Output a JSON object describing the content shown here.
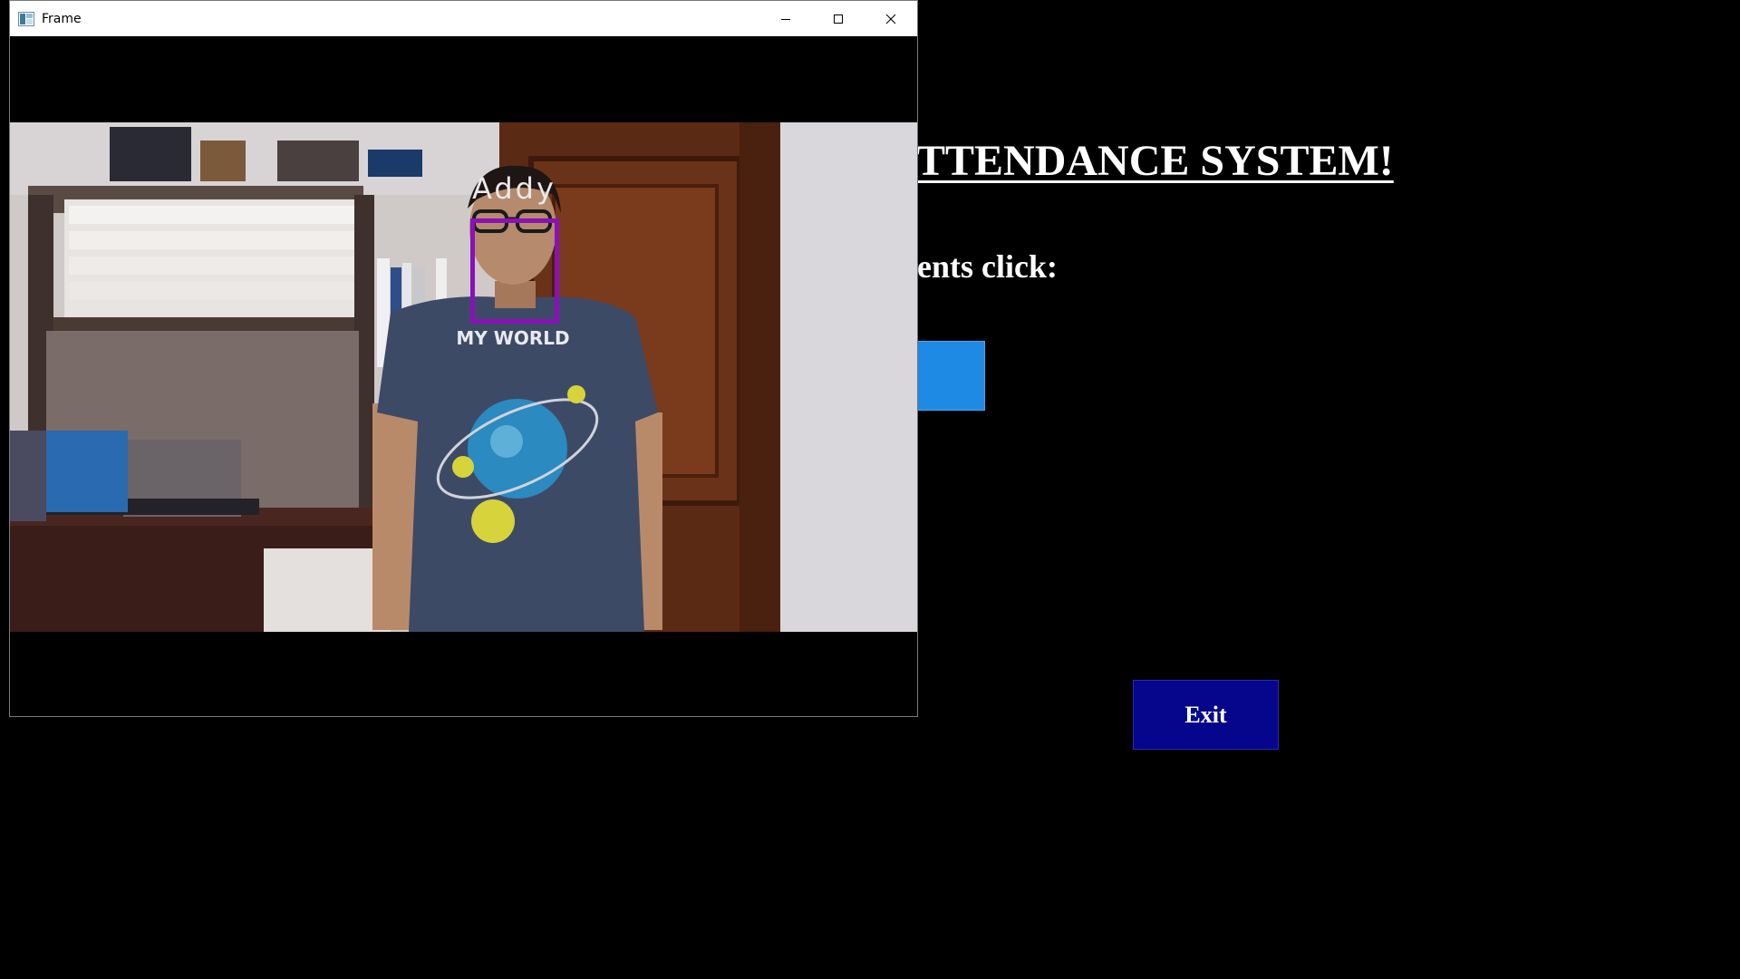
{
  "window": {
    "title": "Frame",
    "controls": {
      "minimize_icon": "minimize-icon",
      "maximize_icon": "maximize-icon",
      "close_icon": "close-icon"
    }
  },
  "video": {
    "detected_name": "Addy",
    "face_box_color": "#8a10b8",
    "shirt_text": "MY WORLD"
  },
  "app": {
    "title": "TTENDANCE SYSTEM!",
    "instruction": "ents click:",
    "take_button_label": "",
    "take_button_color": "#1f8ae4",
    "exit_button_label": "Exit",
    "exit_button_color": "#06068c",
    "background_color": "#000000"
  }
}
